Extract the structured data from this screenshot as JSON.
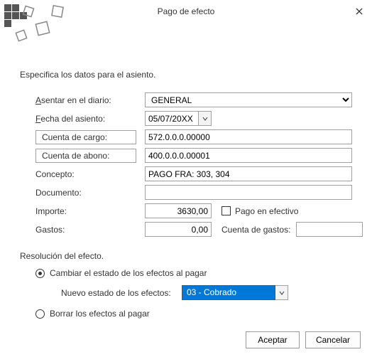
{
  "title": "Pago de efecto",
  "instruction": "Especifica los datos para el asiento.",
  "labels": {
    "diario_access": "A",
    "diario_rest": "sentar en el diario:",
    "fecha_access": "F",
    "fecha_rest": "echa del asiento:",
    "cuenta_cargo": "Cuenta de cargo:",
    "cuenta_abono": "Cuenta de abono:",
    "concepto": "Concepto:",
    "documento": "Documento:",
    "importe": "Importe:",
    "gastos": "Gastos:",
    "pago_efectivo": "Pago en efectivo",
    "cuenta_gastos": "Cuenta de gastos:"
  },
  "values": {
    "diario": "GENERAL",
    "fecha": "05/07/20XX",
    "cuenta_cargo": "572.0.0.0.00000",
    "cuenta_abono": "400.0.0.0.00001",
    "concepto": "PAGO FRA: 303, 304",
    "documento": "",
    "importe": "3630,00",
    "gastos": "0,00",
    "cuenta_gastos": ""
  },
  "resolution": {
    "title": "Resolución del efecto.",
    "option_change": "Cambiar el estado de los efectos al pagar",
    "option_delete": "Borrar los efectos al pagar",
    "new_state_label": "Nuevo estado de los efectos:",
    "new_state_value": "03 - Cobrado"
  },
  "buttons": {
    "accept": "Aceptar",
    "cancel": "Cancelar"
  }
}
